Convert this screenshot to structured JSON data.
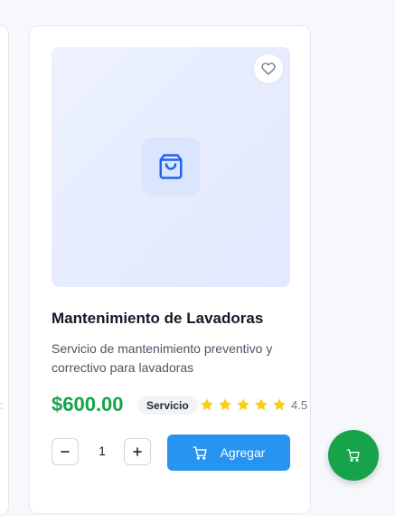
{
  "product": {
    "title": "Mantenimiento de Lavadoras",
    "description": "Servicio de mantenimiento preventivo y correctivo para lavadoras",
    "price": "$600.00",
    "badge": "Servicio",
    "rating": {
      "value": "4.5",
      "stars_filled": 5,
      "stars_total": 5
    },
    "image_icon": "shopping-bag-icon",
    "favorite_icon": "heart-icon"
  },
  "quantity": {
    "value": "1",
    "minus_icon": "minus-icon",
    "plus_icon": "plus-icon"
  },
  "add_button": {
    "label": "Agregar",
    "icon": "cart-icon"
  },
  "floating_cart": {
    "icon": "cart-icon"
  },
  "colors": {
    "price": "#16a34a",
    "add_button": "#2794f2",
    "star": "#facc15",
    "fab": "#16a34a",
    "image_bg": "#e6ecfe"
  }
}
